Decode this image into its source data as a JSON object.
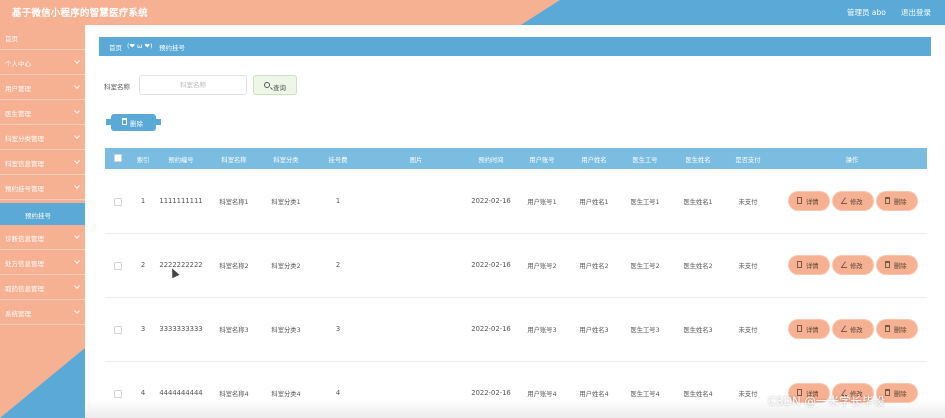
{
  "header": {
    "title": "基于微信小程序的智慧医疗系统",
    "user": "管理员 abo",
    "logout": "退出登录"
  },
  "sidebar": {
    "items": [
      {
        "label": "首页"
      },
      {
        "label": "个人中心"
      },
      {
        "label": "用户管理"
      },
      {
        "label": "医生管理"
      },
      {
        "label": "科室分类管理"
      },
      {
        "label": "科室信息管理"
      },
      {
        "label": "预约挂号管理"
      },
      {
        "label": "诊断信息管理"
      },
      {
        "label": "处方信息管理"
      },
      {
        "label": "取药信息管理"
      },
      {
        "label": "系统管理"
      }
    ],
    "active_sub": "预约挂号"
  },
  "breadcrumb": {
    "home": "首页",
    "emoticon": "(❤ ω ❤)",
    "current": "预约挂号"
  },
  "search": {
    "label": "科室名称",
    "placeholder": "科室名称",
    "button": "查询"
  },
  "bulk_delete": "删除",
  "table": {
    "columns": [
      "索引",
      "预约编号",
      "科室名称",
      "科室分类",
      "挂号费",
      "图片",
      "预约时间",
      "用户账号",
      "用户姓名",
      "医生工号",
      "医生姓名",
      "是否支付",
      "操作"
    ],
    "rows": [
      {
        "index": "1",
        "booking_no": "1111111111",
        "dept_name": "科室名称1",
        "dept_cat": "科室分类1",
        "fee": "1",
        "image": "",
        "time": "2022-02-16",
        "user_acct": "用户账号1",
        "user_name": "用户姓名1",
        "doc_no": "医生工号1",
        "doc_name": "医生姓名1",
        "paid": "未支付"
      },
      {
        "index": "2",
        "booking_no": "2222222222",
        "dept_name": "科室名称2",
        "dept_cat": "科室分类2",
        "fee": "2",
        "image": "",
        "time": "2022-02-16",
        "user_acct": "用户账号2",
        "user_name": "用户姓名2",
        "doc_no": "医生工号2",
        "doc_name": "医生姓名2",
        "paid": "未支付"
      },
      {
        "index": "3",
        "booking_no": "3333333333",
        "dept_name": "科室名称3",
        "dept_cat": "科室分类3",
        "fee": "3",
        "image": "",
        "time": "2022-02-16",
        "user_acct": "用户账号3",
        "user_name": "用户姓名3",
        "doc_no": "医生工号3",
        "doc_name": "医生姓名3",
        "paid": "未支付"
      },
      {
        "index": "4",
        "booking_no": "4444444444",
        "dept_name": "科室名称4",
        "dept_cat": "科室分类4",
        "fee": "4",
        "image": "",
        "time": "2022-02-16",
        "user_acct": "用户账号4",
        "user_name": "用户姓名4",
        "doc_no": "医生工号4",
        "doc_name": "医生姓名4",
        "paid": "未支付"
      }
    ],
    "actions": {
      "detail": "详情",
      "edit": "修改",
      "delete": "删除"
    }
  },
  "watermark": "CSDN @一米学长毕设",
  "colors": {
    "peach": "#f6b193",
    "blue": "#5aa9d6",
    "table_head": "#7bbde0"
  }
}
